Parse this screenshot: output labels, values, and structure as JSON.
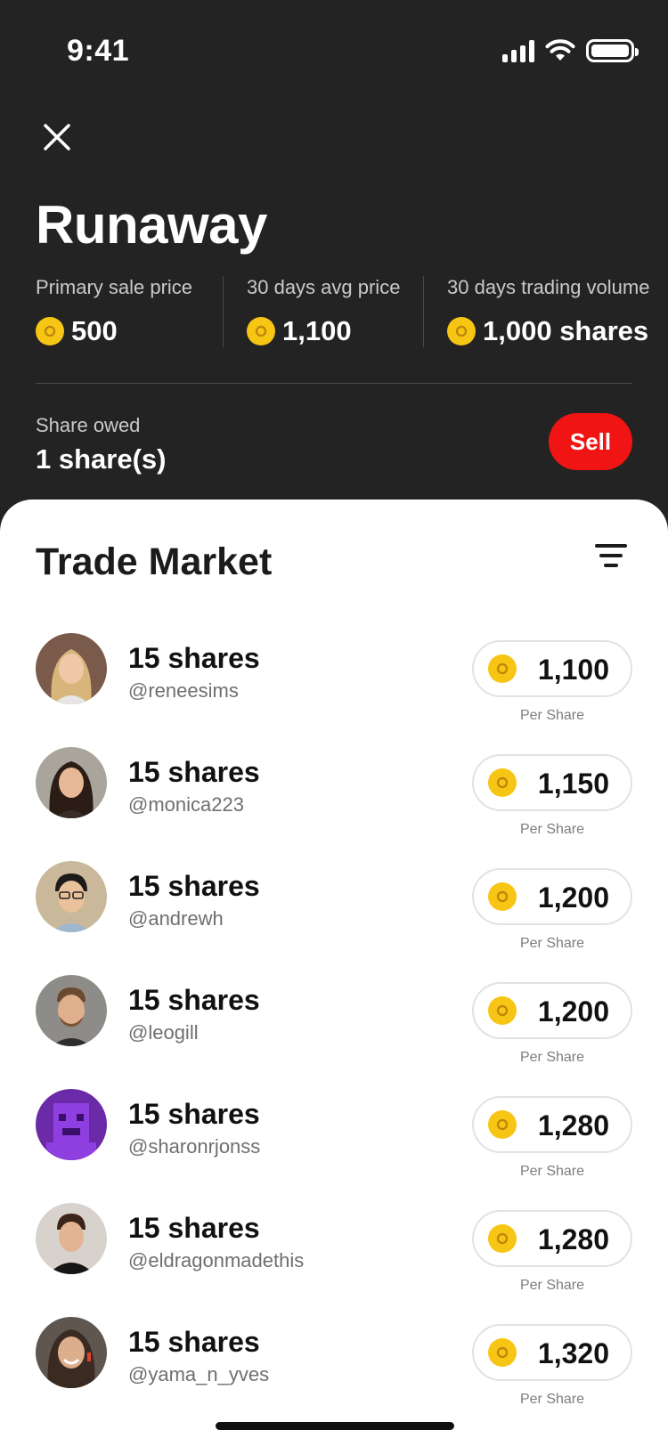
{
  "status_bar": {
    "time": "9:41"
  },
  "header": {
    "title": "Runaway",
    "stats": [
      {
        "label": "Primary sale price",
        "value": "500"
      },
      {
        "label": "30 days avg price",
        "value": "1,100"
      },
      {
        "label": "30 days trading volume",
        "value": "1,000 shares"
      }
    ],
    "share_owed_label": "Share owed",
    "share_owed_value": "1 share(s)",
    "sell_label": "Sell"
  },
  "market": {
    "title": "Trade Market",
    "per_share_label": "Per Share",
    "rows": [
      {
        "shares": "15 shares",
        "user": "@reneesims",
        "price": "1,100"
      },
      {
        "shares": "15 shares",
        "user": "@monica223",
        "price": "1,150"
      },
      {
        "shares": "15 shares",
        "user": "@andrewh",
        "price": "1,200"
      },
      {
        "shares": "15 shares",
        "user": "@leogill",
        "price": "1,200"
      },
      {
        "shares": "15 shares",
        "user": "@sharonrjonss",
        "price": "1,280"
      },
      {
        "shares": "15 shares",
        "user": "@eldragonmadethis",
        "price": "1,280"
      },
      {
        "shares": "15 shares",
        "user": "@yama_n_yves",
        "price": "1,320"
      }
    ]
  },
  "colors": {
    "accent": "#f01414",
    "coin": "#f7c514",
    "background": "#232323"
  }
}
